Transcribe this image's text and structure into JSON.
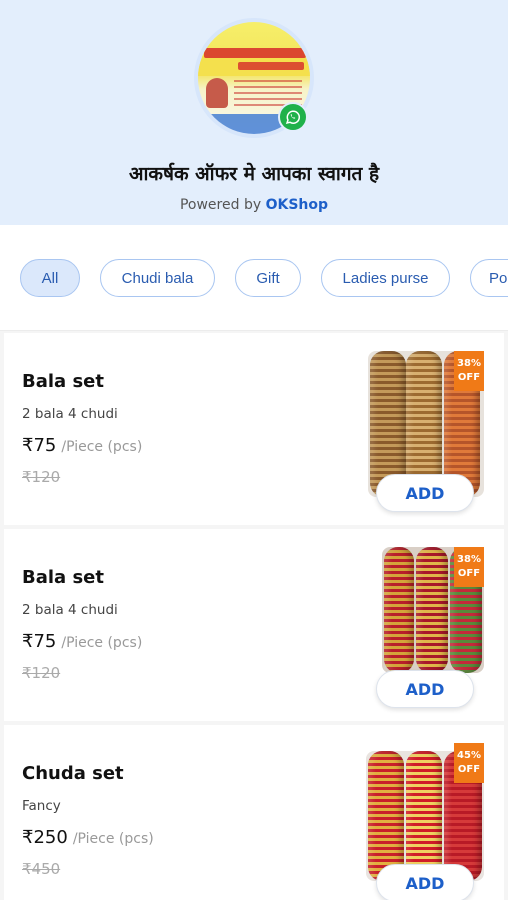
{
  "header": {
    "shop_title": "आकर्षक ऑफर मे आपका स्वागत है",
    "powered_by_prefix": "Powered by",
    "powered_by_brand": "OKShop",
    "whatsapp_icon": "whatsapp-icon",
    "logo_text": "आकर्षक श्रृंगार एवं जेनरल स्टोर एवं गिफ्ट कॉर्नर"
  },
  "categories": [
    {
      "label": "All",
      "active": true
    },
    {
      "label": "Chudi bala",
      "active": false
    },
    {
      "label": "Gift",
      "active": false
    },
    {
      "label": "Ladies purse",
      "active": false
    },
    {
      "label": "Po",
      "active": false
    }
  ],
  "products": [
    {
      "name": "Bala set",
      "description": "2 bala 4 chudi",
      "price": "₹75",
      "unit": "/Piece (pcs)",
      "mrp": "₹120",
      "discount_pct": "38%",
      "discount_label": "OFF",
      "add_label": "ADD"
    },
    {
      "name": "Bala set",
      "description": "2 bala 4 chudi",
      "price": "₹75",
      "unit": "/Piece (pcs)",
      "mrp": "₹120",
      "discount_pct": "38%",
      "discount_label": "OFF",
      "add_label": "ADD"
    },
    {
      "name": "Chuda set",
      "description": "Fancy",
      "price": "₹250",
      "unit": "/Piece (pcs)",
      "mrp": "₹450",
      "discount_pct": "45%",
      "discount_label": "OFF",
      "add_label": "ADD"
    }
  ],
  "colors": {
    "header_bg": "#e3eefc",
    "accent": "#1d5fc9",
    "discount_badge": "#f07a17",
    "whatsapp": "#1fb14a"
  }
}
